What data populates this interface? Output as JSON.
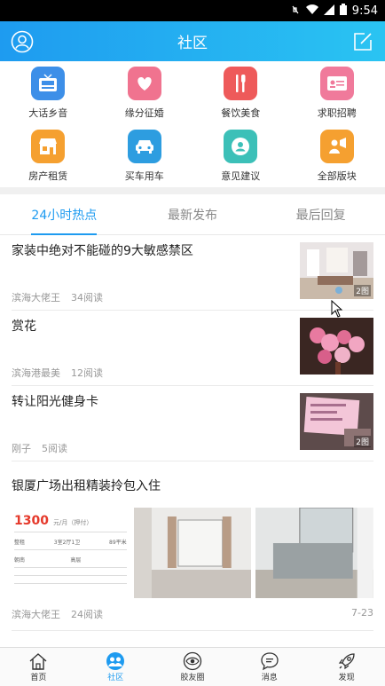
{
  "status_bar": {
    "time": "9:54"
  },
  "header": {
    "title": "社区",
    "left_icon": "user-profile-icon",
    "right_icon": "edit-icon"
  },
  "categories": [
    {
      "label": "大话乡音",
      "icon": "tv-news-icon",
      "color": "#3D8FE8"
    },
    {
      "label": "缘分征婚",
      "icon": "hearts-icon",
      "color": "#F0738F"
    },
    {
      "label": "餐饮美食",
      "icon": "cutlery-icon",
      "color": "#EE5A5A"
    },
    {
      "label": "求职招聘",
      "icon": "id-card-icon",
      "color": "#F07A9B"
    },
    {
      "label": "房产租赁",
      "icon": "storefront-icon",
      "color": "#F5A030"
    },
    {
      "label": "买车用车",
      "icon": "car-icon",
      "color": "#2D9DE0"
    },
    {
      "label": "意见建议",
      "icon": "user-circle-icon",
      "color": "#3CC0B8"
    },
    {
      "label": "全部版块",
      "icon": "megaphone-user-icon",
      "color": "#F5A030"
    }
  ],
  "tabs": [
    {
      "label": "24小时热点",
      "active": true
    },
    {
      "label": "最新发布",
      "active": false
    },
    {
      "label": "最后回复",
      "active": false
    }
  ],
  "posts": [
    {
      "title": "家装中绝对不能碰的9大敏感禁区",
      "author": "滨海大佬王",
      "reads": "34阅读",
      "badge": "2图"
    },
    {
      "title": "赏花",
      "author": "滨海港最美",
      "reads": "12阅读",
      "badge": ""
    },
    {
      "title": "转让阳光健身卡",
      "author": "刚子",
      "reads": "5阅读",
      "badge": "2图"
    }
  ],
  "big_post": {
    "title": "银厦广场出租精装拎包入住",
    "author": "滨海大佬王",
    "reads": "24阅读",
    "date": "7-23",
    "flyer_price": "1300",
    "flyer_unit": "元/月（押付）",
    "flyer_row1": [
      "整租",
      "3室2厅1卫",
      "89平米"
    ],
    "flyer_row2": [
      "朝南",
      "高层"
    ]
  },
  "bottom_nav": [
    {
      "label": "首页",
      "icon": "home-icon",
      "active": false
    },
    {
      "label": "社区",
      "icon": "community-icon",
      "active": true
    },
    {
      "label": "胶友圈",
      "icon": "eye-circle-icon",
      "active": false
    },
    {
      "label": "消息",
      "icon": "chat-bubble-icon",
      "active": false
    },
    {
      "label": "发现",
      "icon": "rocket-icon",
      "active": false
    }
  ]
}
